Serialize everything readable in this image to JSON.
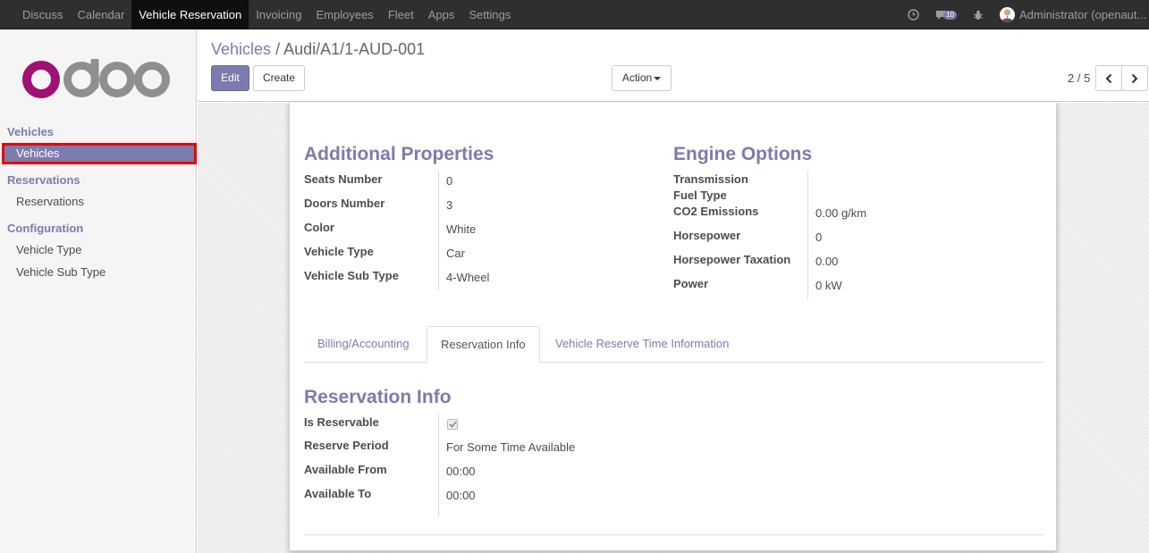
{
  "topnav": {
    "items": [
      "Discuss",
      "Calendar",
      "Vehicle Reservation",
      "Invoicing",
      "Employees",
      "Fleet",
      "Apps",
      "Settings"
    ],
    "active_index": 2,
    "messages_count": "10",
    "user": "Administrator (openaut..."
  },
  "sidebar": {
    "logo_text": "odoo",
    "sections": [
      {
        "title": "Vehicles",
        "items": [
          "Vehicles"
        ]
      },
      {
        "title": "Reservations",
        "items": [
          "Reservations"
        ]
      },
      {
        "title": "Configuration",
        "items": [
          "Vehicle Type",
          "Vehicle Sub Type"
        ]
      }
    ]
  },
  "breadcrumb": {
    "parent": "Vehicles",
    "separator": "/",
    "current": "Audi/A1/1-AUD-001"
  },
  "buttons": {
    "edit": "Edit",
    "create": "Create",
    "action": "Action"
  },
  "pager": {
    "text": "2 / 5"
  },
  "additional_properties": {
    "title": "Additional Properties",
    "fields": [
      {
        "label": "Seats Number",
        "value": "0"
      },
      {
        "label": "Doors Number",
        "value": "3"
      },
      {
        "label": "Color",
        "value": "White"
      },
      {
        "label": "Vehicle Type",
        "value": "Car"
      },
      {
        "label": "Vehicle Sub Type",
        "value": "4-Wheel"
      }
    ]
  },
  "engine_options": {
    "title": "Engine Options",
    "fields": [
      {
        "label": "Transmission",
        "value": ""
      },
      {
        "label": "Fuel Type",
        "value": ""
      },
      {
        "label": "CO2 Emissions",
        "value": "0.00",
        "unit": "g/km"
      },
      {
        "label": "Horsepower",
        "value": "0"
      },
      {
        "label": "Horsepower Taxation",
        "value": "0.00"
      },
      {
        "label": "Power",
        "value": "0",
        "unit": "kW"
      }
    ]
  },
  "tabs": [
    "Billing/Accounting",
    "Reservation Info",
    "Vehicle Reserve Time Information"
  ],
  "active_tab": 1,
  "reservation_info": {
    "title": "Reservation Info",
    "fields": [
      {
        "label": "Is Reservable",
        "checked": true
      },
      {
        "label": "Reserve Period",
        "value": "For Some Time Available"
      },
      {
        "label": "Available From",
        "value": "00:00"
      },
      {
        "label": "Available To",
        "value": "00:00"
      }
    ]
  },
  "colors": {
    "brand": "#7c7bad",
    "navbar": "#2f2f2f",
    "odoo_magenta": "#a01075",
    "odoo_gray": "#8f8f8f"
  }
}
